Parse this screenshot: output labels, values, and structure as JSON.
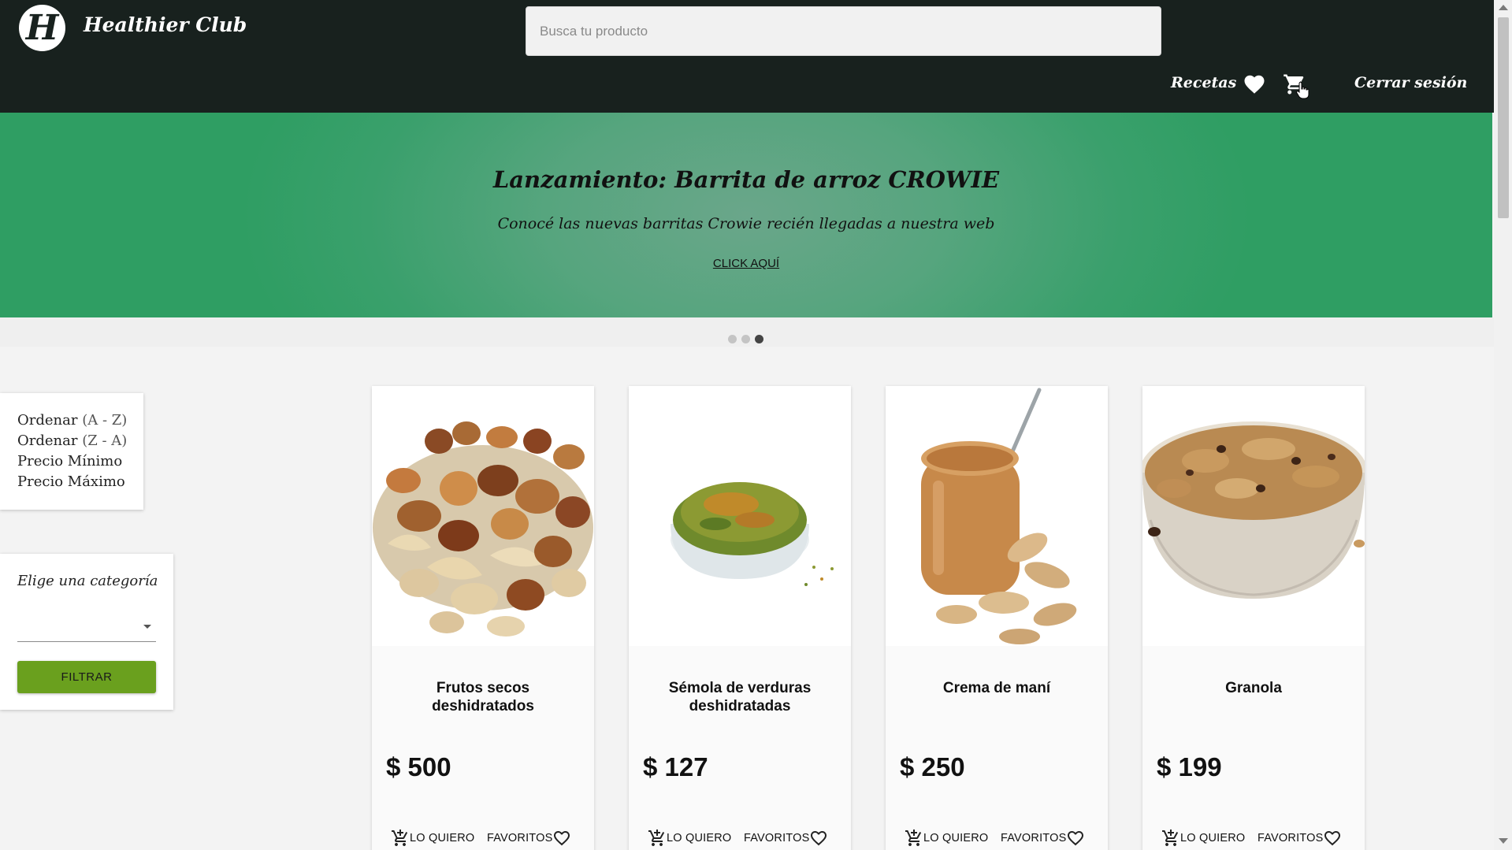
{
  "header": {
    "logo_letter": "H",
    "brand": "Healthier Club",
    "search_placeholder": "Busca tu producto",
    "nav_recetas": "Recetas",
    "nav_logout": "Cerrar sesión",
    "icons": [
      "heart-icon",
      "cart-icon"
    ]
  },
  "hero": {
    "title": "Lanzamiento: Barrita de arroz CROWIE",
    "subtitle": "Conocé las nuevas barritas Crowie recién llegadas a nuestra web",
    "cta": "CLICK AQUÍ",
    "slides": 3,
    "active_slide": 3
  },
  "sidebar": {
    "sort": [
      {
        "word": "Ordenar",
        "range": "(A - Z)"
      },
      {
        "word": "Ordenar",
        "range": "(Z - A)"
      },
      {
        "word": "Precio Mínimo",
        "range": ""
      },
      {
        "word": "Precio Máximo",
        "range": ""
      }
    ],
    "category_label": "Elige una categoría",
    "category_value": "",
    "filter_button": "FILTRAR"
  },
  "products": [
    {
      "title": "Frutos secos deshidratados",
      "price": "$ 500",
      "cart_label": "LO QUIERO",
      "fav_label": "FAVORITOS"
    },
    {
      "title": "Sémola de verduras deshidratadas",
      "price": "$ 127",
      "cart_label": "LO QUIERO",
      "fav_label": "FAVORITOS"
    },
    {
      "title": "Crema de maní",
      "price": "$ 250",
      "cart_label": "LO QUIERO",
      "fav_label": "FAVORITOS"
    },
    {
      "title": "Granola",
      "price": "$ 199",
      "cart_label": "LO QUIERO",
      "fav_label": "FAVORITOS"
    }
  ],
  "colors": {
    "header_bg": "#18211e",
    "hero_green": "#2f9e63",
    "filter_button": "#6aa01e",
    "page_bg": "#f3f3f3"
  }
}
